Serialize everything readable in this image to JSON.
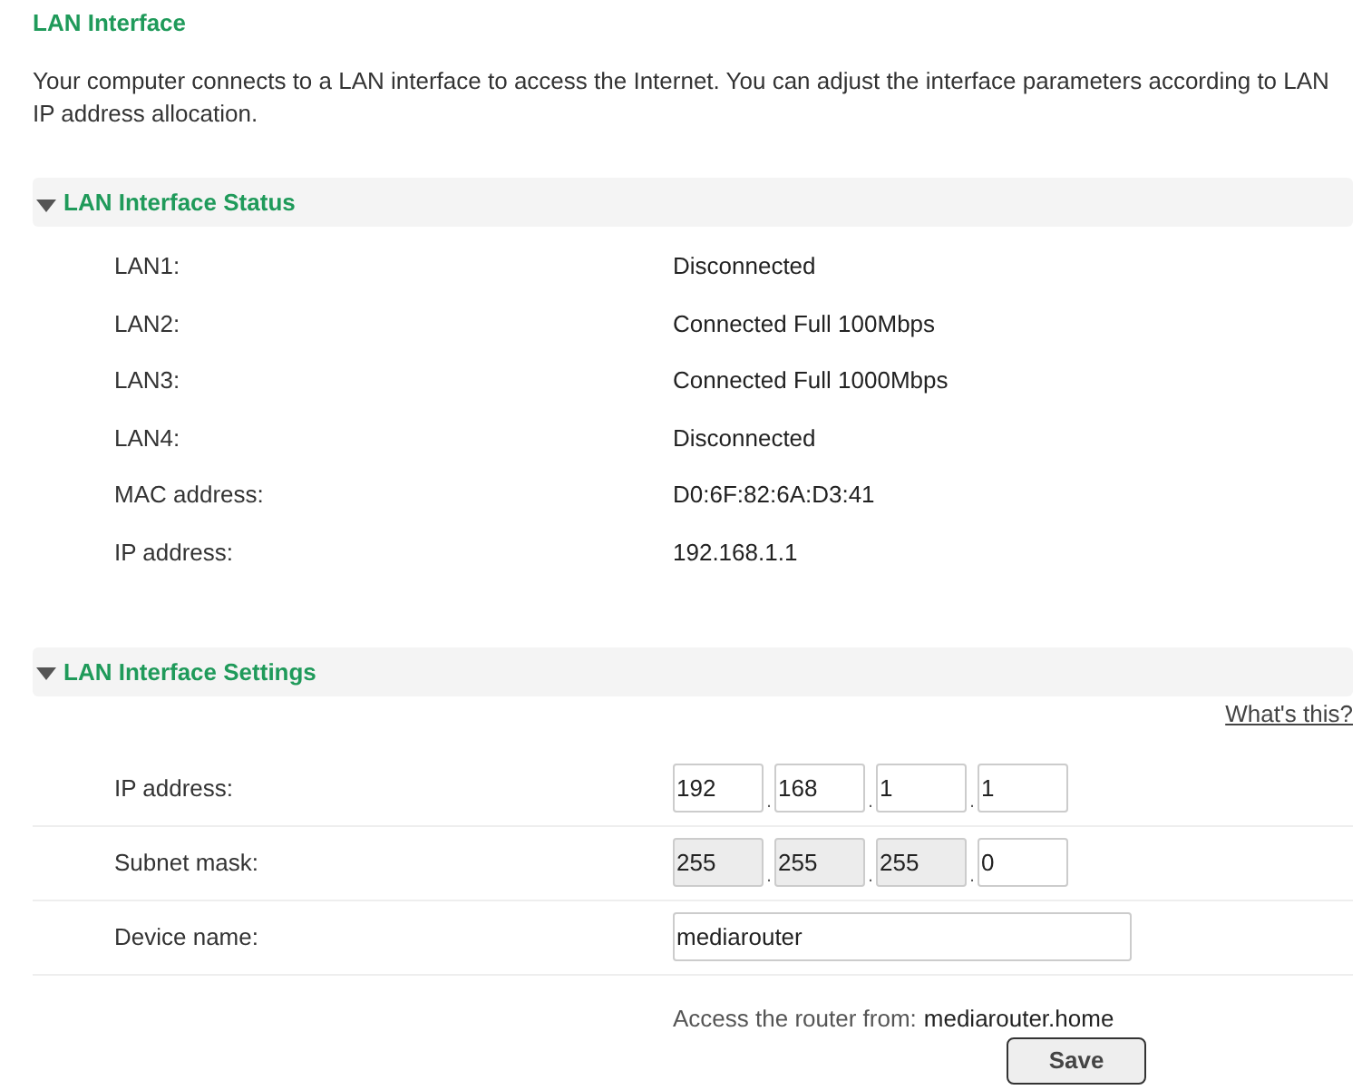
{
  "title": "LAN Interface",
  "intro": "Your computer connects to a LAN interface to access the Internet. You can adjust the interface parameters according to LAN IP address allocation.",
  "status_section": {
    "heading": "LAN Interface Status",
    "expanded": true,
    "rows": [
      {
        "label": "LAN1:",
        "value": "Disconnected"
      },
      {
        "label": "LAN2:",
        "value": "Connected Full 100Mbps"
      },
      {
        "label": "LAN3:",
        "value": "Connected Full 1000Mbps"
      },
      {
        "label": "LAN4:",
        "value": "Disconnected"
      },
      {
        "label": "MAC address:",
        "value": "D0:6F:82:6A:D3:41"
      },
      {
        "label": "IP address:",
        "value": "192.168.1.1"
      }
    ]
  },
  "settings_section": {
    "heading": "LAN Interface Settings",
    "expanded": true,
    "help_link": "What's this?",
    "ip_address": {
      "label": "IP address:",
      "separator": ".",
      "octets": [
        {
          "value": "192",
          "disabled": false
        },
        {
          "value": "168",
          "disabled": false
        },
        {
          "value": "1",
          "disabled": false
        },
        {
          "value": "1",
          "disabled": false
        }
      ]
    },
    "subnet_mask": {
      "label": "Subnet mask:",
      "separator": ".",
      "octets": [
        {
          "value": "255",
          "disabled": true
        },
        {
          "value": "255",
          "disabled": true
        },
        {
          "value": "255",
          "disabled": true
        },
        {
          "value": "0",
          "disabled": false
        }
      ]
    },
    "device_name": {
      "label": "Device name:",
      "value": "mediarouter"
    },
    "access_label": "Access the router from:",
    "access_host": "mediarouter.home",
    "save_button": "Save"
  }
}
